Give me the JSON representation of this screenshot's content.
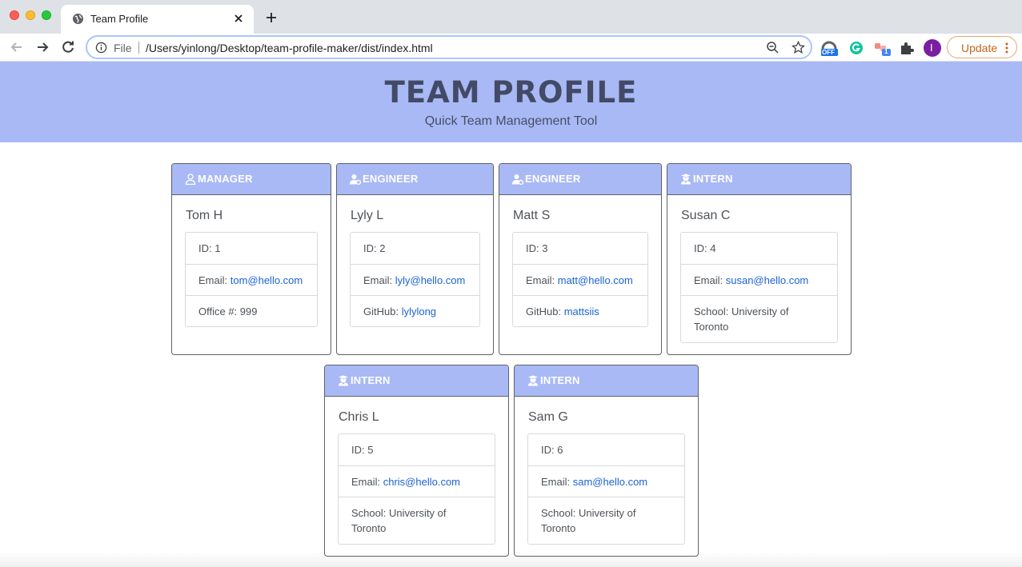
{
  "browser": {
    "tab_title": "Team Profile",
    "url_scheme": "File",
    "url": "/Users/yinlong/Desktop/team-profile-maker/dist/index.html",
    "update_label": "Update",
    "extension_badge_off": "OFF",
    "extension_badge_count": "1",
    "profile_initial": "I"
  },
  "hero": {
    "title": "TEAM PROFILE",
    "subtitle": "Quick Team Management Tool"
  },
  "cards": [
    {
      "role": "MANAGER",
      "role_icon": "user-icon",
      "name": "Tom H",
      "items": [
        {
          "label": "ID: ",
          "value": "1",
          "link": false
        },
        {
          "label": "Email: ",
          "value": "tom@hello.com",
          "link": true
        },
        {
          "label": "Office #: ",
          "value": "999",
          "link": false
        }
      ]
    },
    {
      "role": "ENGINEER",
      "role_icon": "user-gear-icon",
      "name": "Lyly L",
      "items": [
        {
          "label": "ID: ",
          "value": "2",
          "link": false
        },
        {
          "label": "Email: ",
          "value": "lyly@hello.com",
          "link": true
        },
        {
          "label": "GitHub: ",
          "value": "lylylong",
          "link": true
        }
      ]
    },
    {
      "role": "ENGINEER",
      "role_icon": "user-gear-icon",
      "name": "Matt S",
      "items": [
        {
          "label": "ID: ",
          "value": "3",
          "link": false
        },
        {
          "label": "Email: ",
          "value": "matt@hello.com",
          "link": true
        },
        {
          "label": "GitHub: ",
          "value": "mattsiis",
          "link": true
        }
      ]
    },
    {
      "role": "INTERN",
      "role_icon": "user-graduate-icon",
      "name": "Susan C",
      "items": [
        {
          "label": "ID: ",
          "value": "4",
          "link": false
        },
        {
          "label": "Email: ",
          "value": "susan@hello.com",
          "link": true
        },
        {
          "label": "School: ",
          "value": "University of Toronto",
          "link": false
        }
      ]
    },
    {
      "role": "INTERN",
      "role_icon": "user-graduate-icon",
      "name": "Chris L",
      "items": [
        {
          "label": "ID: ",
          "value": "5",
          "link": false
        },
        {
          "label": "Email: ",
          "value": "chris@hello.com",
          "link": true
        },
        {
          "label": "School: ",
          "value": "University of Toronto",
          "link": false
        }
      ]
    },
    {
      "role": "INTERN",
      "role_icon": "user-graduate-icon",
      "name": "Sam G",
      "items": [
        {
          "label": "ID: ",
          "value": "6",
          "link": false
        },
        {
          "label": "Email: ",
          "value": "sam@hello.com",
          "link": true
        },
        {
          "label": "School: ",
          "value": "University of Toronto",
          "link": false
        }
      ]
    }
  ]
}
